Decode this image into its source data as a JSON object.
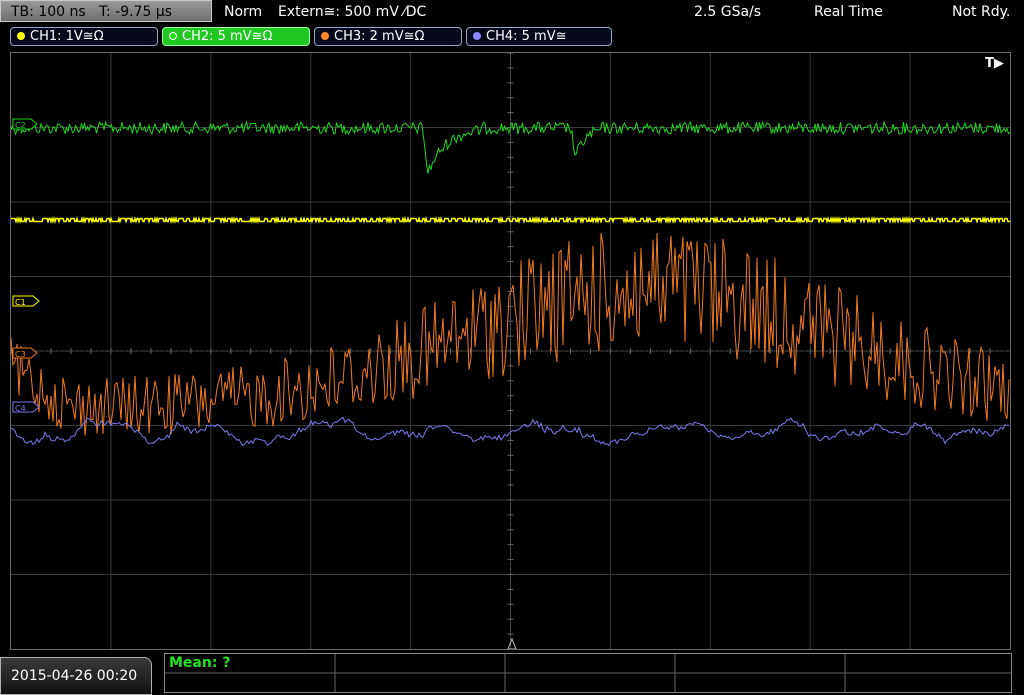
{
  "header": {
    "timebase": "TB: 100 ns   T: -9.75 µs",
    "mode": "Norm",
    "trigger": "Extern≅: 500 mV ⁄DC",
    "sample_rate": "2.5 GSa/s",
    "acq_mode": "Real Time",
    "status": "Not Rdy."
  },
  "channels": [
    {
      "label": "CH1: 1V≅Ω",
      "color": "#ffff00",
      "active": false
    },
    {
      "label": "CH2: 5 mV≅Ω",
      "color": "#22dd22",
      "active": true
    },
    {
      "label": "CH3: 2 mV≅Ω",
      "color": "#ff8a30",
      "active": false
    },
    {
      "label": "CH4: 5 mV≅",
      "color": "#8888ff",
      "active": false
    }
  ],
  "markers": {
    "trigger": "T▶",
    "c1": "C1",
    "c2": "C2",
    "c3": "C3",
    "c4": "C4"
  },
  "measurement": {
    "label": "Mean: ?"
  },
  "footer": {
    "datetime": "2015-04-26 00:20"
  },
  "colors": {
    "ch1": "#ffff00",
    "ch2": "#1fd61f",
    "ch3": "#ef7a22",
    "ch4": "#7a7aee",
    "grid": "#3a3a3a"
  }
}
